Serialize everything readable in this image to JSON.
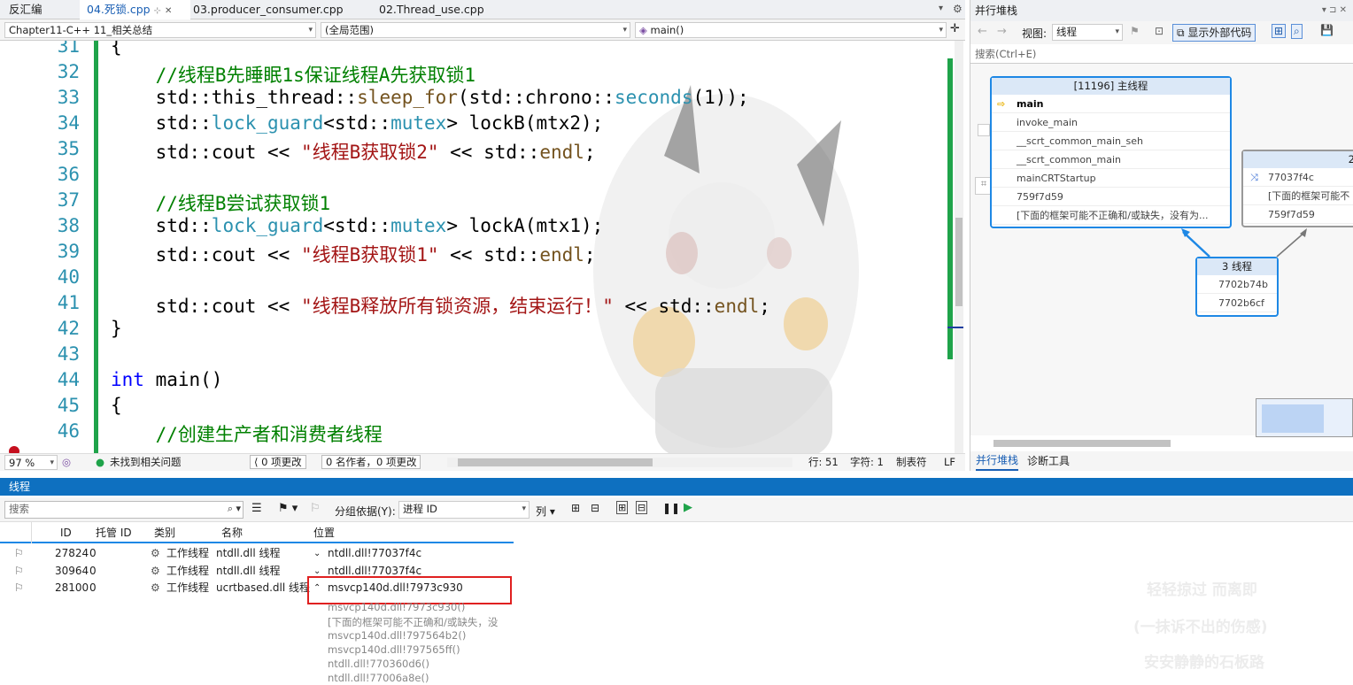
{
  "tabs": [
    "反汇编",
    "04.死锁.cpp",
    "03.producer_consumer.cpp",
    "02.Thread_use.cpp"
  ],
  "tab_pin": "⊹",
  "tab_close": "✕",
  "nav": {
    "project": "Chapter11-C++ 11_相关总结",
    "scope": "(全局范围)",
    "function": "main()"
  },
  "line_numbers": [
    "31",
    "32",
    "33",
    "34",
    "35",
    "36",
    "37",
    "38",
    "39",
    "40",
    "41",
    "42",
    "43",
    "44",
    "45",
    "46"
  ],
  "code_lines": [
    [
      {
        "c": "",
        "t": "{"
      }
    ],
    [
      {
        "c": "cm",
        "t": "    //线程B先睡眠1s保证线程A先获取锁1"
      }
    ],
    [
      {
        "c": "",
        "t": "    std::this_thread::"
      },
      {
        "c": "fn",
        "t": "sleep_for"
      },
      {
        "c": "",
        "t": "(std::chrono::"
      },
      {
        "c": "ty",
        "t": "seconds"
      },
      {
        "c": "",
        "t": "(1));"
      }
    ],
    [
      {
        "c": "",
        "t": "    std::"
      },
      {
        "c": "ty",
        "t": "lock_guard"
      },
      {
        "c": "",
        "t": "<std::"
      },
      {
        "c": "ty",
        "t": "mutex"
      },
      {
        "c": "",
        "t": "> lockB(mtx2);"
      }
    ],
    [
      {
        "c": "",
        "t": "    std::cout << "
      },
      {
        "c": "st",
        "t": "\"线程B获取锁2\""
      },
      {
        "c": "",
        "t": " << std::"
      },
      {
        "c": "fn",
        "t": "endl"
      },
      {
        "c": "",
        "t": ";"
      }
    ],
    [
      {
        "c": "",
        "t": ""
      }
    ],
    [
      {
        "c": "cm",
        "t": "    //线程B尝试获取锁1"
      }
    ],
    [
      {
        "c": "",
        "t": "    std::"
      },
      {
        "c": "ty",
        "t": "lock_guard"
      },
      {
        "c": "",
        "t": "<std::"
      },
      {
        "c": "ty",
        "t": "mutex"
      },
      {
        "c": "",
        "t": "> lockA(mtx1);"
      }
    ],
    [
      {
        "c": "",
        "t": "    std::cout << "
      },
      {
        "c": "st",
        "t": "\"线程B获取锁1\""
      },
      {
        "c": "",
        "t": " << std::"
      },
      {
        "c": "fn",
        "t": "endl"
      },
      {
        "c": "",
        "t": ";"
      }
    ],
    [
      {
        "c": "",
        "t": ""
      }
    ],
    [
      {
        "c": "",
        "t": "    std::cout << "
      },
      {
        "c": "st",
        "t": "\"线程B释放所有锁资源，结束运行！\""
      },
      {
        "c": "",
        "t": " << std::"
      },
      {
        "c": "fn",
        "t": "endl"
      },
      {
        "c": "",
        "t": ";"
      }
    ],
    [
      {
        "c": "",
        "t": "}"
      }
    ],
    [
      {
        "c": "",
        "t": ""
      }
    ],
    [
      {
        "c": "kw",
        "t": "int"
      },
      {
        "c": "",
        "t": " main()"
      }
    ],
    [
      {
        "c": "",
        "t": "{"
      }
    ],
    [
      {
        "c": "cm",
        "t": "    //创建生产者和消费者线程"
      }
    ]
  ],
  "status": {
    "zoom": "97 %",
    "issues": "未找到相关问题",
    "changes": "0 项更改",
    "authors": "0 名作者，0 项更改",
    "line": "行: 51",
    "col": "字符: 1",
    "tab": "制表符",
    "eol": "LF"
  },
  "right_panel": {
    "title": "并行堆栈",
    "view_label": "视图:",
    "view_value": "线程",
    "show_external": "显示外部代码",
    "search": "搜索(Ctrl+E)",
    "main_box": {
      "header": "[11196] 主线程",
      "rows": [
        "main",
        "invoke_main",
        "__scrt_common_main_seh",
        "__scrt_common_main",
        "mainCRTStartup",
        "759f7d59",
        "[下面的框架可能不正确和/或缺失，没有为..."
      ]
    },
    "box2": {
      "header": "2",
      "rows": [
        "77037f4c",
        "[下面的框架可能不",
        "759f7d59"
      ]
    },
    "box3": {
      "header": "3 线程",
      "rows": [
        "7702b74b",
        "7702b6cf"
      ]
    },
    "tabs": [
      "并行堆栈",
      "诊断工具"
    ]
  },
  "threads": {
    "title": "线程",
    "search": "搜索",
    "group_label": "分组依据(Y):",
    "group_value": "进程 ID",
    "columns_label": "列",
    "headers": [
      "ID",
      "托管 ID",
      "类别",
      "名称",
      "位置"
    ],
    "rows": [
      {
        "id": "27824",
        "mid": "0",
        "cat": "工作线程",
        "name": "ntdll.dll 线程",
        "loc": "ntdll.dll!77037f4c"
      },
      {
        "id": "30964",
        "mid": "0",
        "cat": "工作线程",
        "name": "ntdll.dll 线程",
        "loc": "ntdll.dll!77037f4c"
      },
      {
        "id": "28100",
        "mid": "0",
        "cat": "工作线程",
        "name": "ucrtbased.dll 线程",
        "loc": "msvcp140d.dll!7973c930"
      }
    ],
    "stack": [
      "msvcp140d.dll!7973c930()",
      "[下面的框架可能不正确和/或缺失，没",
      "msvcp140d.dll!797564b2()",
      "msvcp140d.dll!797565ff()",
      "ntdll.dll!770360d6()",
      "ntdll.dll!77006a8e()"
    ]
  },
  "watermark": [
    "轻轻掠过 而离即",
    "(一抹诉不出的伤感)",
    "安安静静的石板路"
  ]
}
